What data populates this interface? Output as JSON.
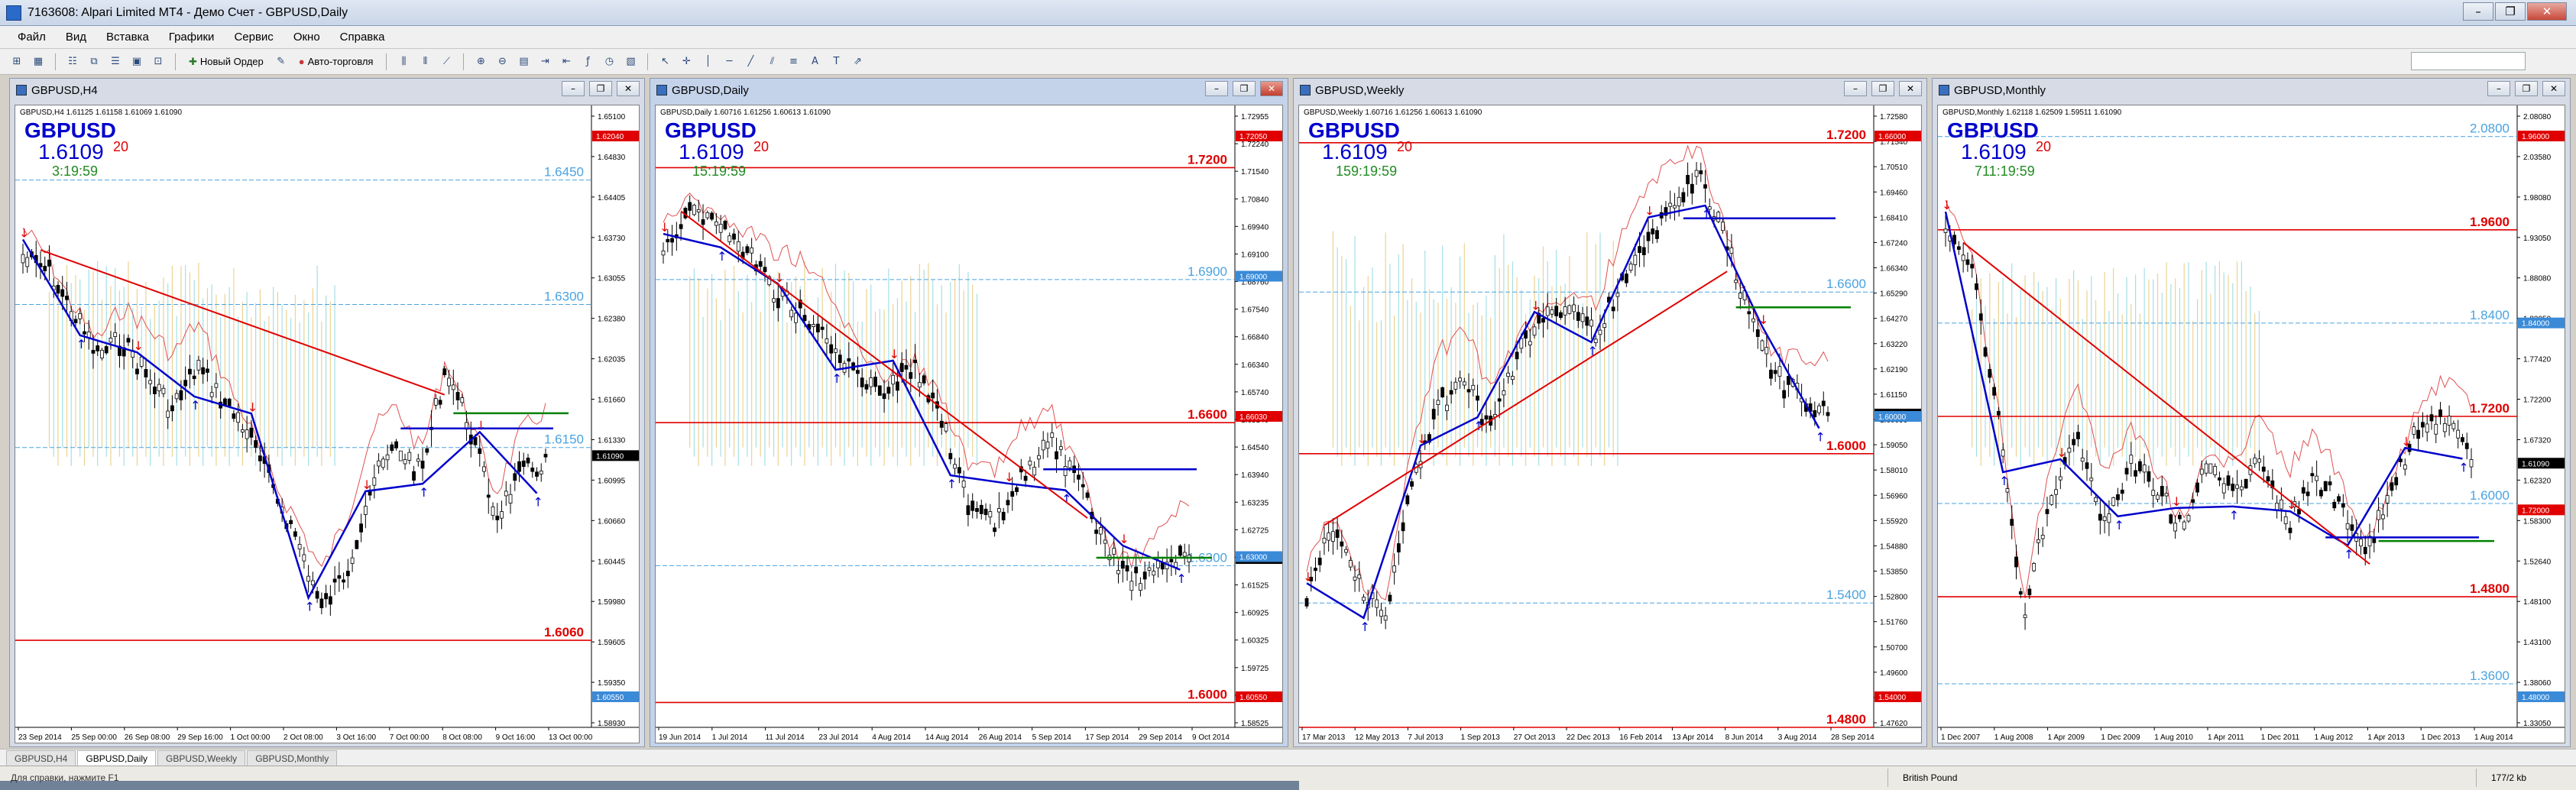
{
  "window": {
    "title": "7163608: Alpari Limited MT4 - Демо Счет - GBPUSD,Daily",
    "buttons": {
      "minimize": "–",
      "restore": "❐",
      "close": "✕"
    }
  },
  "menu": [
    "Файл",
    "Вид",
    "Вставка",
    "Графики",
    "Сервис",
    "Окно",
    "Справка"
  ],
  "toolbar": {
    "new_order": "Новый Ордер",
    "autotrading": "Авто-торговля"
  },
  "charts": [
    {
      "title": "GBPUSD,H4",
      "info": "GBPUSD,H4  1.61125 1.61158 1.61069 1.61090",
      "symbol": "GBPUSD",
      "price_big": "1.6109",
      "price_sup": "20",
      "timer": "3:19:59",
      "y_ticks": [
        "1.65100",
        "1.64830",
        "1.64405",
        "1.63730",
        "1.63055",
        "1.62380",
        "1.62035",
        "1.61660",
        "1.61330",
        "1.60995",
        "1.60660",
        "1.60445",
        "1.59980",
        "1.59605",
        "1.59350",
        "1.58930"
      ],
      "x_ticks": [
        "23 Sep 2014",
        "25 Sep 00:00",
        "26 Sep 08:00",
        "29 Sep 16:00",
        "1 Oct 00:00",
        "2 Oct 08:00",
        "3 Oct 16:00",
        "7 Oct 00:00",
        "8 Oct 08:00",
        "9 Oct 16:00",
        "13 Oct 00:00"
      ],
      "levels": [
        {
          "label": "1.6450",
          "color": "#4aa3e0"
        },
        {
          "label": "1.6300",
          "color": "#4aa3e0"
        },
        {
          "label": "1.6150",
          "color": "#4aa3e0"
        },
        {
          "label": "1.6060",
          "color": "#e00000"
        }
      ],
      "price_tag": "1.61090",
      "level_tags": [
        "1.62040",
        "1.60550"
      ]
    },
    {
      "title": "GBPUSD,Daily",
      "info": "GBPUSD,Daily  1.60716 1.61256 1.60613 1.61090",
      "symbol": "GBPUSD",
      "price_big": "1.6109",
      "price_sup": "20",
      "timer": "15:19:59",
      "y_ticks": [
        "1.72955",
        "1.72240",
        "1.71540",
        "1.70840",
        "1.69940",
        "1.69100",
        "1.68760",
        "1.67540",
        "1.66840",
        "1.66340",
        "1.65740",
        "1.65140",
        "1.64540",
        "1.63940",
        "1.63235",
        "1.62725",
        "1.62125",
        "1.61525",
        "1.60925",
        "1.60325",
        "1.59725",
        "1.59125",
        "1.58525"
      ],
      "x_ticks": [
        "19 Jun 2014",
        "1 Jul 2014",
        "11 Jul 2014",
        "23 Jul 2014",
        "4 Aug 2014",
        "14 Aug 2014",
        "26 Aug 2014",
        "5 Sep 2014",
        "17 Sep 2014",
        "29 Sep 2014",
        "9 Oct 2014"
      ],
      "levels": [
        {
          "label": "1.7200",
          "color": "#e00000"
        },
        {
          "label": "1.6900",
          "color": "#4aa3e0"
        },
        {
          "label": "1.6600",
          "color": "#e00000"
        },
        {
          "label": "1.6300",
          "color": "#4aa3e0"
        },
        {
          "label": "1.6000",
          "color": "#e00000"
        }
      ],
      "price_tag": "1.61090",
      "level_tags": [
        "1.72050",
        "1.69000",
        "1.66030",
        "1.63000",
        "1.60550"
      ]
    },
    {
      "title": "GBPUSD,Weekly",
      "info": "GBPUSD,Weekly  1.60716 1.61256 1.60613 1.61090",
      "symbol": "GBPUSD",
      "price_big": "1.6109",
      "price_sup": "20",
      "timer": "159:19:59",
      "y_ticks": [
        "1.72580",
        "1.71540",
        "1.70510",
        "1.69460",
        "1.68410",
        "1.67240",
        "1.66340",
        "1.65290",
        "1.64270",
        "1.63220",
        "1.62190",
        "1.61150",
        "1.60090",
        "1.59050",
        "1.58010",
        "1.56960",
        "1.55920",
        "1.54880",
        "1.53850",
        "1.52800",
        "1.51760",
        "1.50700",
        "1.49600",
        "1.48660",
        "1.47620"
      ],
      "x_ticks": [
        "17 Mar 2013",
        "12 May 2013",
        "7 Jul 2013",
        "1 Sep 2013",
        "27 Oct 2013",
        "22 Dec 2013",
        "16 Feb 2014",
        "13 Apr 2014",
        "8 Jun 2014",
        "3 Aug 2014",
        "28 Sep 2014"
      ],
      "levels": [
        {
          "label": "1.7200",
          "color": "#e00000"
        },
        {
          "label": "1.6600",
          "color": "#4aa3e0"
        },
        {
          "label": "1.6000",
          "color": "#e00000"
        },
        {
          "label": "1.5400",
          "color": "#4aa3e0"
        },
        {
          "label": "1.4800",
          "color": "#e00000"
        }
      ],
      "price_tag": "1.61090",
      "level_tags": [
        "1.66000",
        "1.60000",
        "1.54000"
      ]
    },
    {
      "title": "GBPUSD,Monthly",
      "info": "GBPUSD,Monthly  1.62118 1.62509 1.59511 1.61090",
      "symbol": "GBPUSD",
      "price_big": "1.6109",
      "price_sup": "20",
      "timer": "711:19:59",
      "y_ticks": [
        "2.08080",
        "2.03580",
        "1.98080",
        "1.93050",
        "1.88080",
        "1.83050",
        "1.77420",
        "1.72200",
        "1.67320",
        "1.62320",
        "1.58300",
        "1.52640",
        "1.48100",
        "1.43100",
        "1.38060",
        "1.33050"
      ],
      "x_ticks": [
        "1 Dec 2007",
        "1 Aug 2008",
        "1 Apr 2009",
        "1 Dec 2009",
        "1 Aug 2010",
        "1 Apr 2011",
        "1 Dec 2011",
        "1 Aug 2012",
        "1 Apr 2013",
        "1 Dec 2013",
        "1 Aug 2014"
      ],
      "levels": [
        {
          "label": "2.0800",
          "color": "#4aa3e0"
        },
        {
          "label": "1.9600",
          "color": "#e00000"
        },
        {
          "label": "1.8400",
          "color": "#4aa3e0"
        },
        {
          "label": "1.7200",
          "color": "#e00000"
        },
        {
          "label": "1.6000",
          "color": "#4aa3e0"
        },
        {
          "label": "1.4800",
          "color": "#e00000"
        },
        {
          "label": "1.3600",
          "color": "#4aa3e0"
        }
      ],
      "price_tag": "1.61090",
      "level_tags": [
        "1.96000",
        "1.84000",
        "1.72000",
        "1.48000"
      ]
    }
  ],
  "tabs": [
    "GBPUSD,H4",
    "GBPUSD,Daily",
    "GBPUSD,Weekly",
    "GBPUSD,Monthly"
  ],
  "active_tab": 1,
  "status": {
    "help": "Для справки, нажмите F1",
    "profile": "British Pound",
    "traffic": "177/2 kb"
  },
  "colors": {
    "blue_text": "#0000cc",
    "red_level": "#e00000",
    "blue_level": "#4aa3e0",
    "zigzag": "#0000cc",
    "trend_red": "#e00000",
    "trend_green": "#008000",
    "histo_yellow": "#e8c878",
    "histo_cyan": "#8fd8e0"
  }
}
